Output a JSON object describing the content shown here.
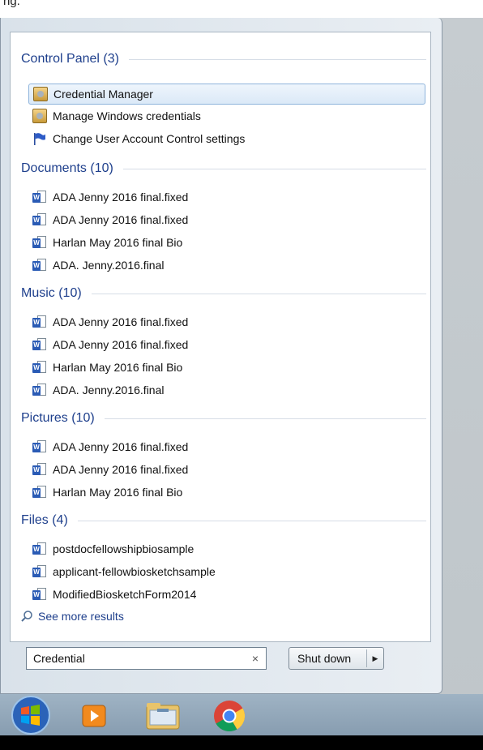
{
  "top_partial_text": "ng.",
  "groups": [
    {
      "label": "Control Panel (3)",
      "items": [
        "Credential Manager",
        "Manage Windows credentials",
        "Change User Account Control settings"
      ]
    },
    {
      "label": "Documents (10)",
      "items": [
        "ADA  Jenny 2016 final.fixed",
        "ADA  Jenny 2016 final.fixed",
        "Harlan May 2016 final Bio",
        "ADA. Jenny.2016.final"
      ]
    },
    {
      "label": "Music (10)",
      "items": [
        "ADA  Jenny 2016 final.fixed",
        "ADA  Jenny 2016 final.fixed",
        "Harlan May 2016 final Bio",
        "ADA. Jenny.2016.final"
      ]
    },
    {
      "label": "Pictures (10)",
      "items": [
        "ADA  Jenny 2016 final.fixed",
        "ADA  Jenny 2016 final.fixed",
        "Harlan May 2016 final Bio"
      ]
    },
    {
      "label": "Files (4)",
      "items": [
        "postdocfellowshipbiosample",
        "applicant-fellowbiosketchsample",
        "ModifiedBiosketchForm2014"
      ]
    }
  ],
  "see_more": "See more results",
  "search": {
    "value": "Credential",
    "clear": "×"
  },
  "shutdown": {
    "label": "Shut down",
    "arrow": "▶"
  },
  "colors": {
    "accent": "#1e3f8c",
    "selection": "#dbe9f7",
    "taskbar": "#8ea3b6"
  },
  "taskbar_icons": [
    "start-orb-icon",
    "media-player-icon",
    "file-explorer-icon",
    "chrome-icon"
  ]
}
